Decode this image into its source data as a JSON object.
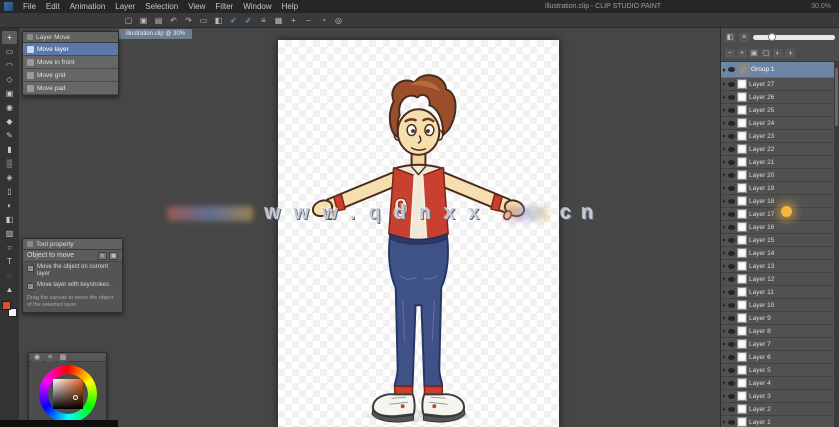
{
  "app": {
    "title": "illustration.clip - CLIP STUDIO PAINT",
    "right_info": "30.0%"
  },
  "menu": {
    "items": [
      {
        "name": "menu-file",
        "label": "File"
      },
      {
        "name": "menu-edit",
        "label": "Edit"
      },
      {
        "name": "menu-animation",
        "label": "Animation"
      },
      {
        "name": "menu-layer",
        "label": "Layer"
      },
      {
        "name": "menu-selection",
        "label": "Selection"
      },
      {
        "name": "menu-view",
        "label": "View"
      },
      {
        "name": "menu-filter",
        "label": "Filter"
      },
      {
        "name": "menu-window",
        "label": "Window"
      },
      {
        "name": "menu-help",
        "label": "Help"
      }
    ]
  },
  "commandbar": {
    "icons": [
      {
        "name": "new-file-icon",
        "glyph": "▢"
      },
      {
        "name": "open-file-icon",
        "glyph": "▣"
      },
      {
        "name": "save-icon",
        "glyph": "▤"
      },
      {
        "name": "undo-icon",
        "glyph": "↶"
      },
      {
        "name": "redo-icon",
        "glyph": "↷"
      },
      {
        "name": "clear-icon",
        "glyph": "▭"
      },
      {
        "name": "fill-icon",
        "glyph": "◧"
      },
      {
        "name": "snap-on-icon",
        "glyph": "✓",
        "active": true
      },
      {
        "name": "snap-special-ruler-icon",
        "glyph": "✓",
        "active": true
      },
      {
        "name": "ruler-icon",
        "glyph": "≡"
      },
      {
        "name": "grid-icon",
        "glyph": "▦"
      },
      {
        "name": "zoom-in-icon",
        "glyph": "+"
      },
      {
        "name": "zoom-out-icon",
        "glyph": "−"
      },
      {
        "name": "rotate-view-icon",
        "glyph": "◔"
      },
      {
        "name": "settings-icon",
        "glyph": "◎"
      }
    ]
  },
  "tools": {
    "items": [
      {
        "name": "move-tool",
        "glyph": "+",
        "active": true
      },
      {
        "name": "marquee-tool",
        "glyph": "▭"
      },
      {
        "name": "lasso-tool",
        "glyph": "◠"
      },
      {
        "name": "magic-wand-tool",
        "glyph": "◇"
      },
      {
        "name": "crop-tool",
        "glyph": "▣"
      },
      {
        "name": "eyedropper-tool",
        "glyph": "◉"
      },
      {
        "name": "pen-tool",
        "glyph": "◆"
      },
      {
        "name": "pencil-tool",
        "glyph": "✎"
      },
      {
        "name": "brush-tool",
        "glyph": "▮"
      },
      {
        "name": "airbrush-tool",
        "glyph": "▒"
      },
      {
        "name": "decoration-tool",
        "glyph": "◈"
      },
      {
        "name": "eraser-tool",
        "glyph": "▯"
      },
      {
        "name": "blend-tool",
        "glyph": "◐"
      },
      {
        "name": "fill-tool",
        "glyph": "◧"
      },
      {
        "name": "gradient-tool",
        "glyph": "▨"
      },
      {
        "name": "figure-tool",
        "glyph": "○"
      },
      {
        "name": "text-tool",
        "glyph": "T"
      },
      {
        "name": "balloon-tool",
        "glyph": "◌"
      },
      {
        "name": "operation-tool",
        "glyph": "▲"
      }
    ],
    "fg_color": "#d4552f",
    "bg_color": "#f5f5f5"
  },
  "subtool": {
    "title": "Layer Move",
    "items": [
      {
        "name": "subtool-move-layer",
        "label": "Move layer",
        "selected": true
      },
      {
        "name": "subtool-move-front",
        "label": "Move in front"
      },
      {
        "name": "subtool-move-grid",
        "label": "Move grid"
      },
      {
        "name": "subtool-move-pad",
        "label": "Move pad"
      }
    ]
  },
  "toolprop": {
    "title": "Tool property",
    "field_label": "Object to move",
    "options": [
      {
        "name": "option-move-current-layer",
        "label": "Move the object on current layer",
        "glyph": "✓",
        "checked": true
      },
      {
        "name": "option-move-keystroke",
        "label": "Move layer with keystrokes",
        "glyph": "✓",
        "checked": true
      }
    ],
    "hint": "Drag the canvas to move the object of the selected layer."
  },
  "colorwheel": {
    "icons": [
      {
        "name": "color-circle-icon",
        "glyph": "◉"
      },
      {
        "name": "color-slider-icon",
        "glyph": "≡"
      },
      {
        "name": "color-set-icon",
        "glyph": "▦"
      }
    ]
  },
  "canvas": {
    "doc_tab": "illustration.clip @ 30%",
    "emblem": "0",
    "watermark_main": "www.qdnxx",
    "watermark_suffix": "cn"
  },
  "navigator": {
    "icons_top": [
      {
        "name": "nav-preview-icon",
        "glyph": "◧"
      },
      {
        "name": "nav-menu-icon",
        "glyph": "≡"
      }
    ],
    "icons": [
      {
        "name": "zoom-out-icon",
        "glyph": "−"
      },
      {
        "name": "zoom-in-icon",
        "glyph": "+"
      },
      {
        "name": "fit-to-screen-icon",
        "glyph": "▣"
      },
      {
        "name": "actual-size-icon",
        "glyph": "▢"
      },
      {
        "name": "rotate-left-icon",
        "glyph": "◐"
      },
      {
        "name": "rotate-right-icon",
        "glyph": "◑"
      }
    ]
  },
  "layers": {
    "items": [
      {
        "name": "Group 1",
        "type": "group",
        "selected": true
      },
      {
        "name": "Layer 27"
      },
      {
        "name": "Layer 26"
      },
      {
        "name": "Layer 25"
      },
      {
        "name": "Layer 24"
      },
      {
        "name": "Layer 23"
      },
      {
        "name": "Layer 22"
      },
      {
        "name": "Layer 21"
      },
      {
        "name": "Layer 20"
      },
      {
        "name": "Layer 19"
      },
      {
        "name": "Layer 18"
      },
      {
        "name": "Layer 17"
      },
      {
        "name": "Layer 16"
      },
      {
        "name": "Layer 15"
      },
      {
        "name": "Layer 14"
      },
      {
        "name": "Layer 13"
      },
      {
        "name": "Layer 12"
      },
      {
        "name": "Layer 11"
      },
      {
        "name": "Layer 10"
      },
      {
        "name": "Layer 9"
      },
      {
        "name": "Layer 8"
      },
      {
        "name": "Layer 7"
      },
      {
        "name": "Layer 6"
      },
      {
        "name": "Layer 5"
      },
      {
        "name": "Layer 4"
      },
      {
        "name": "Layer 3"
      },
      {
        "name": "Layer 2"
      },
      {
        "name": "Layer 1"
      }
    ]
  }
}
